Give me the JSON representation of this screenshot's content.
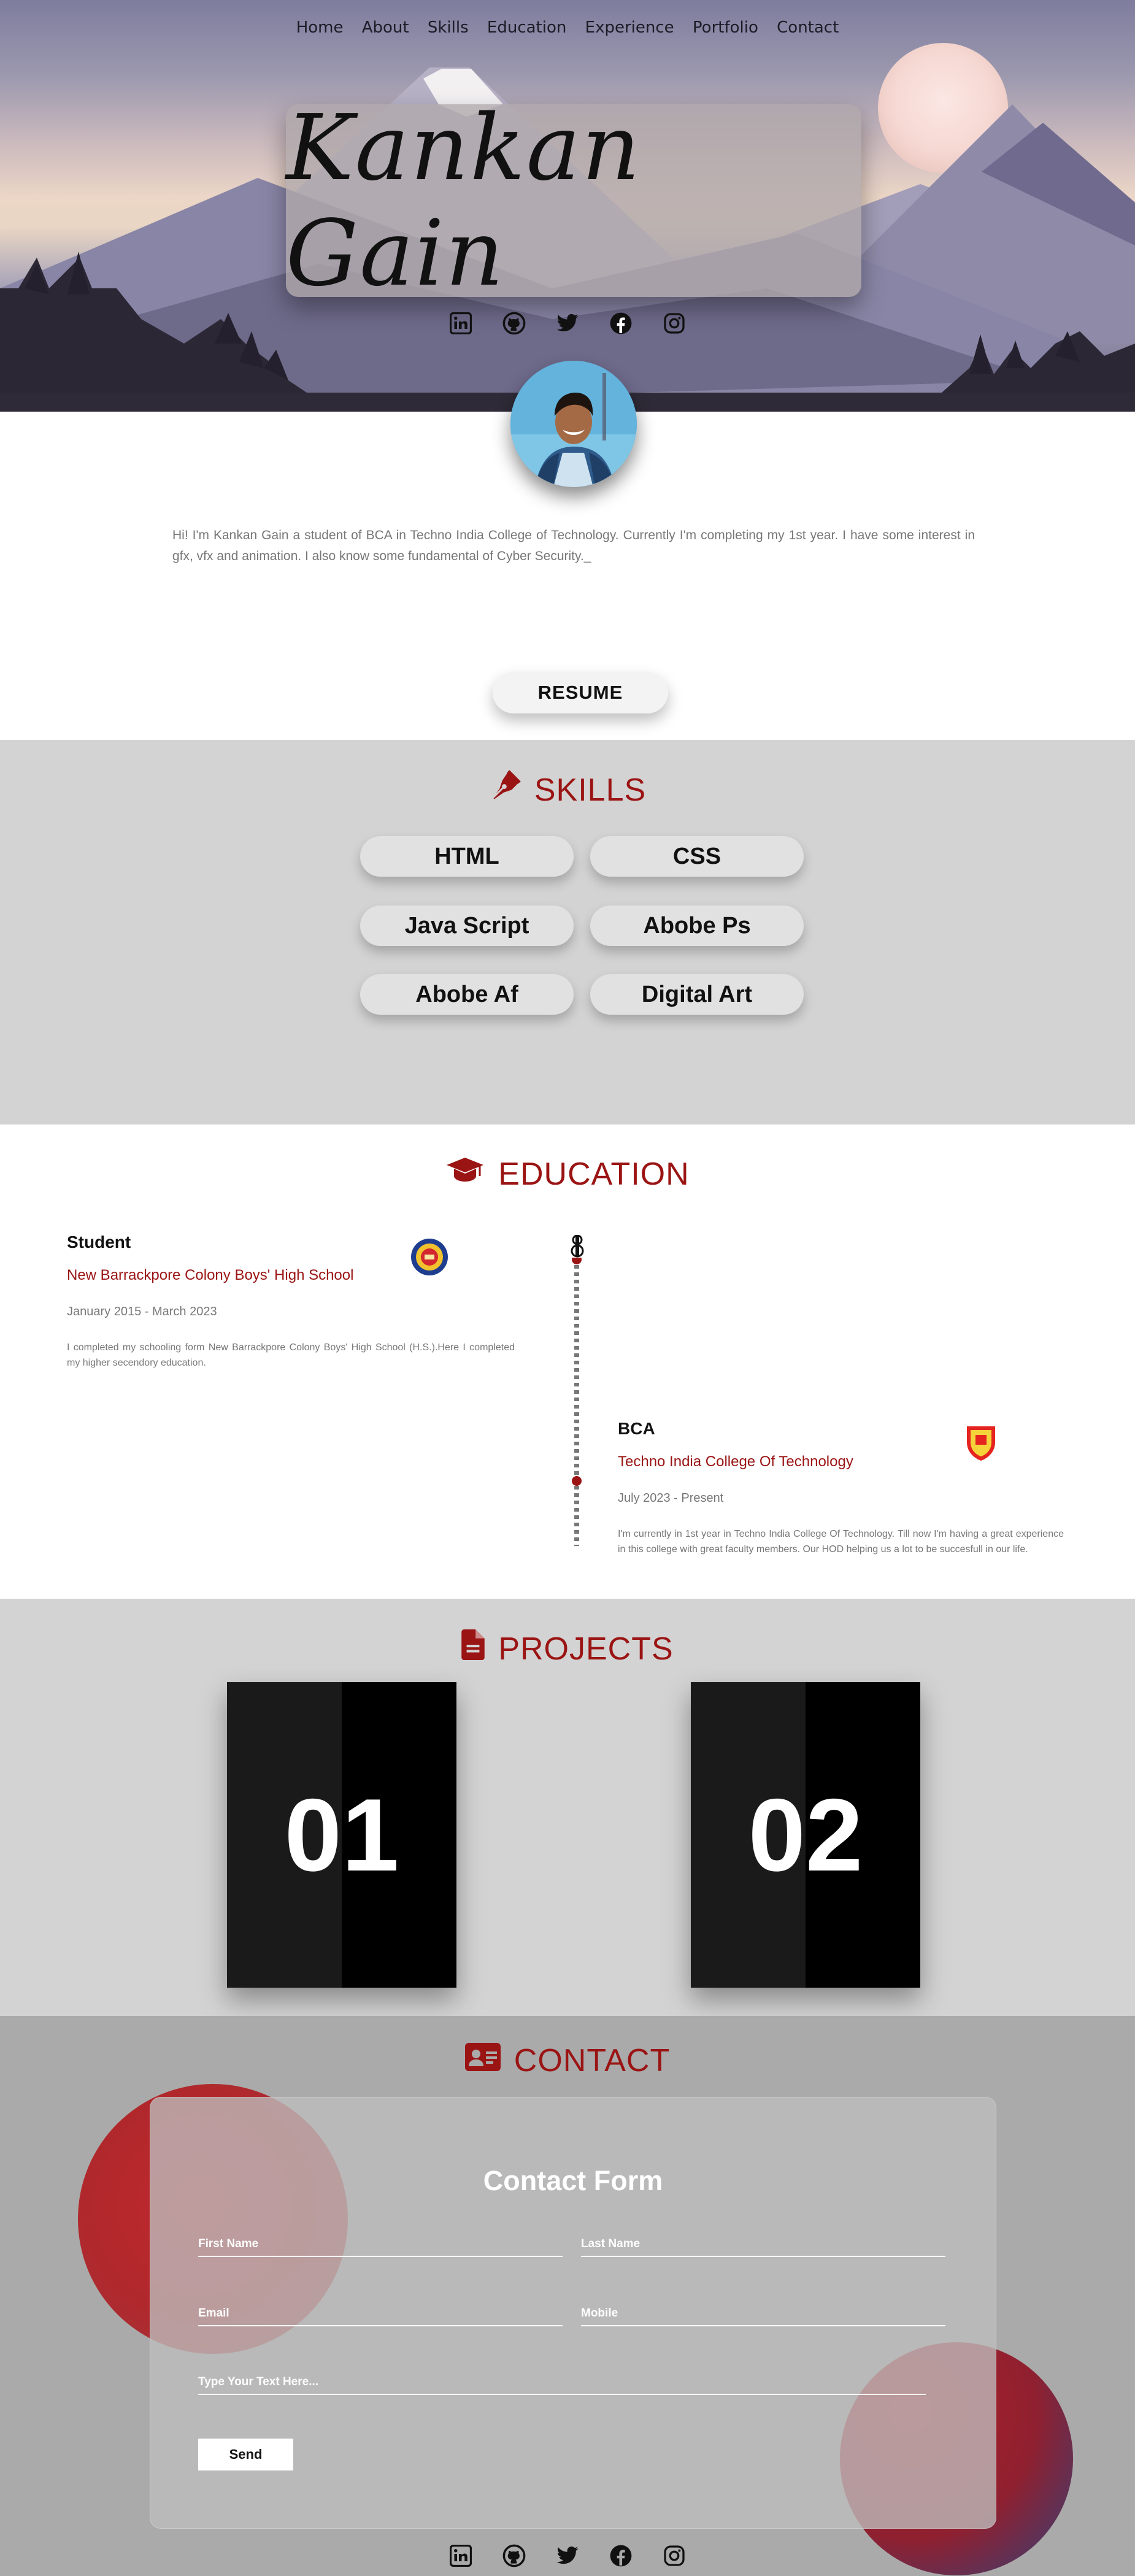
{
  "nav": [
    "Home",
    "About",
    "Skills",
    "Education",
    "Experience",
    "Portfolio",
    "Contact"
  ],
  "hero": {
    "name": "Kankan Gain"
  },
  "social": [
    "linkedin-icon",
    "github-icon",
    "twitter-icon",
    "facebook-icon",
    "instagram-icon"
  ],
  "about": {
    "bio": "Hi! I'm Kankan Gain a student of BCA in Techno India College of Technology. Currently I'm completing my 1st year. I have some interest in gfx, vfx and animation. I also know some fundamental of Cyber Security._",
    "resume_label": "RESUME"
  },
  "skills": {
    "title": "SKILLS",
    "items": [
      "HTML",
      "CSS",
      "Java Script",
      "Abobe Ps",
      "Abobe Af",
      "Digital Art"
    ]
  },
  "education": {
    "title": "EDUCATION",
    "entries": [
      {
        "degree": "Student",
        "school": "New Barrackpore Colony Boys' High School",
        "dates": "January 2015 - March 2023",
        "description": "I completed my schooling form New Barrackpore Colony Boys' High School (H.S.).Here I completed my higher secendory education."
      },
      {
        "degree": "BCA",
        "school": "Techno India College Of Technology",
        "dates": "July 2023 - Present",
        "description": "I'm currently in 1st year in Techno India College Of Technology. Till now I'm having a great experience in this college with great faculty members. Our HOD helping us a lot to be succesfull in our life."
      }
    ]
  },
  "projects": {
    "title": "PROJECTS",
    "items": [
      "01",
      "02"
    ]
  },
  "contact": {
    "title": "CONTACT",
    "form_title": "Contact Form",
    "first_name": "First Name",
    "last_name": "Last Name",
    "email": "Email",
    "mobile": "Mobile",
    "message": "Type Your Text Here...",
    "send_label": "Send"
  },
  "colors": {
    "accent": "#9b1414",
    "section_gray": "#d3d3d3",
    "contact_bg": "#aaaaaa"
  }
}
